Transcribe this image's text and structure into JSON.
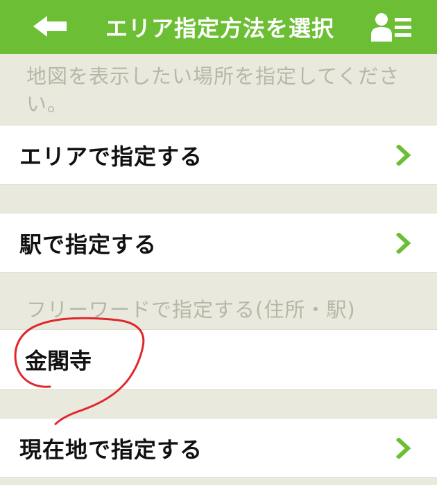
{
  "header": {
    "title": "エリア指定方法を選択",
    "back_icon": "arrow-left-icon",
    "menu_icon": "user-list-icon"
  },
  "instruction": "地図を表示したい場所を指定してください。",
  "options": [
    {
      "label": "エリアで指定する",
      "icon": "chevron-right-icon"
    },
    {
      "label": "駅で指定する",
      "icon": "chevron-right-icon"
    }
  ],
  "freeword": {
    "section_label": "フリーワードで指定する(住所・駅)",
    "value": "金閣寺"
  },
  "current_location": {
    "label": "現在地で指定する",
    "icon": "chevron-right-icon"
  },
  "colors": {
    "header": "#6cbf35",
    "accent": "#6cbf35",
    "background": "#e9e9dd",
    "annotation": "#e0262b"
  }
}
